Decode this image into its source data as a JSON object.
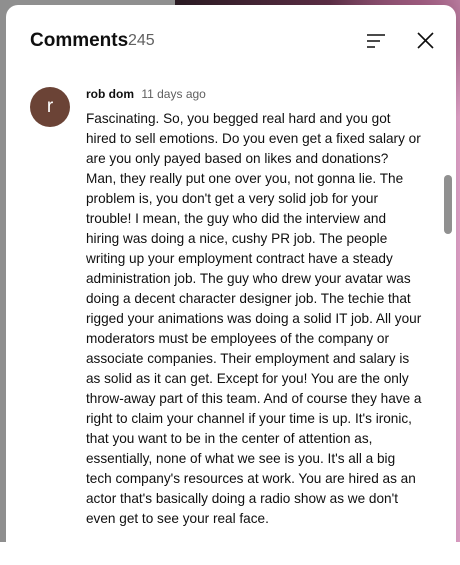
{
  "header": {
    "title": "Comments",
    "count": "245"
  },
  "icons": {
    "sort": "sort-icon",
    "close": "close-icon"
  },
  "comments": [
    {
      "avatar_letter": "r",
      "avatar_color": "#6b4336",
      "author": "rob dom",
      "time": "11 days ago",
      "text": "Fascinating. So, you begged real hard and you got hired to sell emotions. Do you even get a fixed salary or are you only payed based on likes and donations? Man, they really put one over you, not gonna lie. The problem is, you don't get a very solid job for your trouble! I mean, the guy who did the interview and hiring was doing a nice, cushy PR job. The people writing up your employment contract have a steady administration job. The guy who drew your avatar was doing a decent character designer job. The techie that rigged your animations was doing a solid IT job. All your moderators must be employees of the company or associate companies. Their employment and salary is as solid as it can get. Except for you! You are the only throw-away part of this team. And of course they have a right to claim your channel if your time is up. It's ironic, that you want to be in the center of attention as, essentially, none of what we see is you. It's all a big tech company's resources at work. You are hired as an actor that's basically doing a radio show as we don't even get to see your real face."
    }
  ]
}
